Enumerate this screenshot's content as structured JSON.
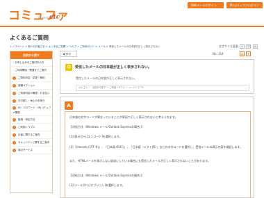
{
  "header": {
    "logo": "コミュファ",
    "logo_sub": "Powered by",
    "logo_ctc": "ctc",
    "buttons": [
      "Webメールログイン",
      "Myコミュファログイン"
    ]
  },
  "page_title": "よくあるご質問",
  "breadcrumb": {
    "links": [
      "トップページ",
      "個人のお客さま",
      "よくあるご質問",
      "ヘルプ",
      "ご利用ガイド",
      "メール"
    ],
    "separator": ">",
    "current": "受信したメールの日本語が正しく表示されない"
  },
  "font_size": {
    "label": "文字サイズ変更",
    "options": [
      "小",
      "中",
      "大"
    ]
  },
  "sidebar": {
    "header": "目的から探す",
    "items": [
      {
        "type": "link",
        "label": "お申し込みをご検討中の方"
      },
      {
        "type": "link",
        "label": "ご利用開始・開通までご案内"
      },
      {
        "type": "cat",
        "label": "ご契約内容・変更・解約"
      },
      {
        "type": "cat",
        "label": "各種オプション"
      },
      {
        "type": "cat",
        "label": "ご利用料金の確認・お支払い"
      },
      {
        "type": "cat",
        "label": "お引越し・休止の手続き"
      },
      {
        "type": "cat",
        "label": "ID・パスワード・Myコミュファ関連"
      },
      {
        "type": "cat",
        "label": "接続・設定方法"
      },
      {
        "type": "cat",
        "label": "ご利用トラブル"
      },
      {
        "type": "cat",
        "label": "災害に関するご案内"
      },
      {
        "type": "cat",
        "label": "セキュリティに関するご案内"
      },
      {
        "type": "cat",
        "label": "周辺サービス"
      }
    ]
  },
  "content": {
    "back_label": "◀ 戻る",
    "question_no": "No: 314",
    "question_badge": "Q",
    "question_title": "受信したメールの日本語が正しく表示されない。",
    "question_body": "受信したメールの日本語が正しく表示されない。",
    "question_category": "カテゴリー： 目的から探す ＞ ご利用トラブル ＞ メールトラブル",
    "answer_badge": "A",
    "answer_lines": [
      "日本語の文字コードが異なっていることが原因で正しく表示されないと考えられます。",
      "【対処方法（Windows メール/Outlook Expressの場合）】",
      "(1)[表示]から[エンコード]を選択します。",
      "(2)「Unicode (UTF-8)」、「日本語 (EUC)」、「日本語（シフトJIS）」などの文字コードを選択し、受信メールの表示内容を確認します。",
      "また、HTMLメールを表示しない設定にしている場合にも受信したメールが正しく表示されないことがあります。",
      "【対処方法（Windows メール/Outlook Expressの場合）】",
      "(1)[ツール]から[オプション]を選択します。"
    ]
  },
  "colors": {
    "accent": "#f07a1e",
    "q_badge": "#f5c400",
    "link": "#0057a8"
  }
}
